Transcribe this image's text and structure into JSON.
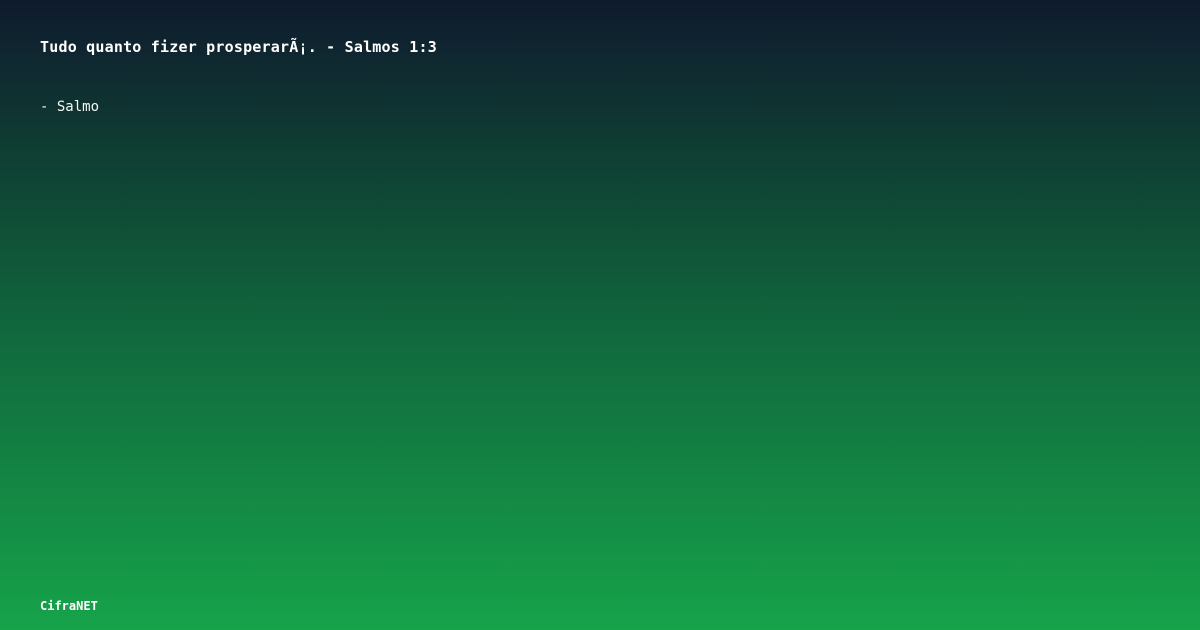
{
  "quote": {
    "text": "Tudo quanto fizer prosperarÃ¡. - Salmos 1:3"
  },
  "author": {
    "text": "- Salmo"
  },
  "brand": {
    "name": "CifraNET"
  },
  "colors": {
    "gradient_top": "#0f1a2e",
    "gradient_bottom": "#16a34a",
    "text": "#ffffff"
  }
}
